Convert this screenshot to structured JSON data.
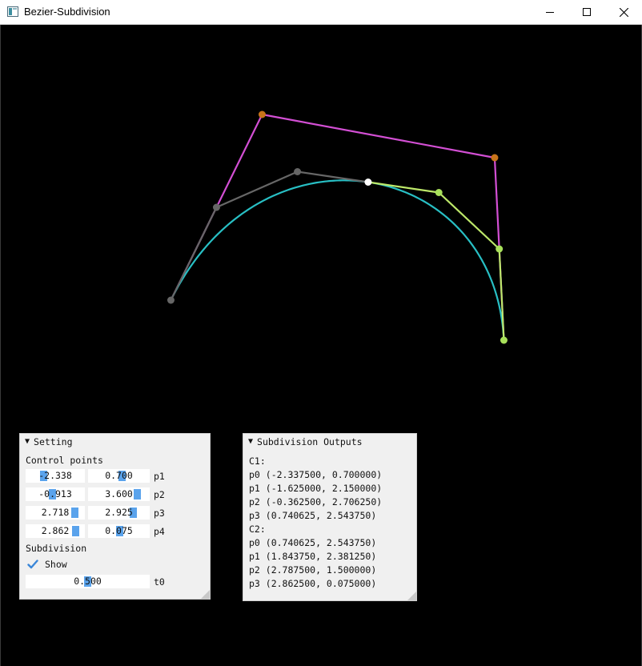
{
  "window": {
    "title": "Bezier-Subdivision",
    "minimize_icon": "minimize-icon",
    "maximize_icon": "maximize-icon",
    "close_icon": "close-icon"
  },
  "colors": {
    "control_polygon": "#d34fd4",
    "control_point": "#c8741a",
    "curve": "#28bfc4",
    "c1_polygon": "#676767",
    "c1_point": "#666666",
    "c2_polygon": "#bde86a",
    "c2_point": "#a8e05a",
    "split_point": "#ffffff",
    "slider_grab": "#5aa3ec",
    "panel_bg": "#f0f0f0"
  },
  "setting_panel": {
    "title": "Setting",
    "control_points_label": "Control points",
    "points": [
      {
        "x": "-2.338",
        "y": "0.700",
        "label": "p1"
      },
      {
        "x": "-0.913",
        "y": "3.600",
        "label": "p2"
      },
      {
        "x": "2.718",
        "y": "2.925",
        "label": "p3"
      },
      {
        "x": "2.862",
        "y": "0.075",
        "label": "p4"
      }
    ],
    "subdivision_label": "Subdivision",
    "show_label": "Show",
    "show_checked": true,
    "t0_value": "0.500",
    "t0_label": "t0"
  },
  "output_panel": {
    "title": "Subdivision Outputs",
    "lines": [
      "C1:",
      "p0 (-2.337500, 0.700000)",
      "p1 (-1.625000, 2.150000)",
      "p2 (-0.362500, 2.706250)",
      "p3 (0.740625, 2.543750)",
      "C2:",
      "p0 (0.740625, 2.543750)",
      "p1 (1.843750, 2.381250)",
      "p2 (2.787500, 1.500000)",
      "p3 (2.862500, 0.075000)"
    ]
  }
}
